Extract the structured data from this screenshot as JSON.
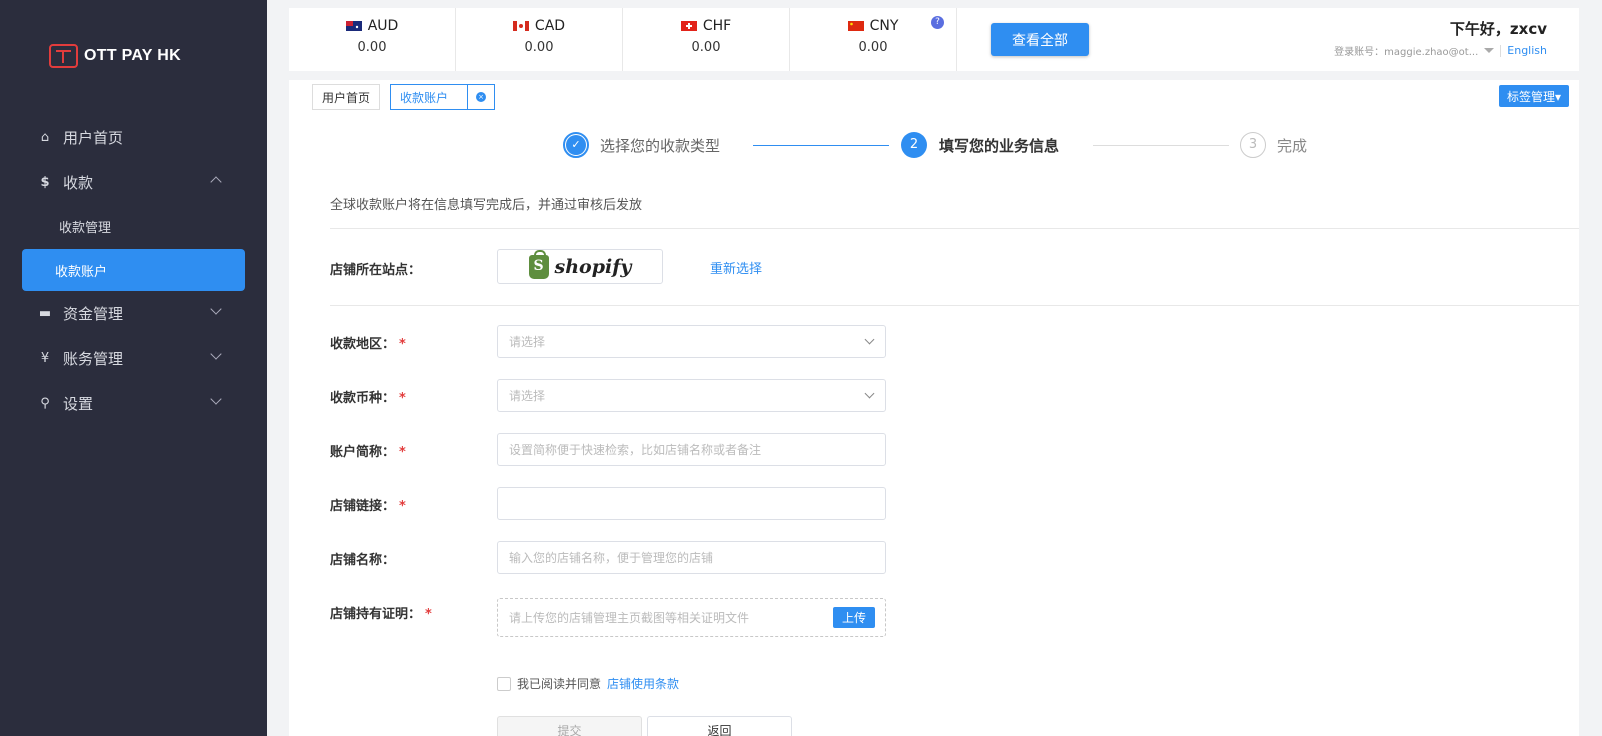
{
  "brand": {
    "logo_text": "OTT PAY HK",
    "accent": "#2f8ef1",
    "sidebar_bg": "#2b2d3d"
  },
  "sidebar": {
    "items": [
      {
        "label": "用户首页",
        "icon": "home-icon"
      },
      {
        "label": "收款",
        "icon": "dollar-icon"
      },
      {
        "label": "资金管理",
        "icon": "card-icon"
      },
      {
        "label": "账务管理",
        "icon": "yen-icon"
      },
      {
        "label": "设置",
        "icon": "search-icon"
      }
    ],
    "sub_items": [
      {
        "label": "收款管理"
      },
      {
        "label": "收款账户",
        "active": true
      }
    ]
  },
  "topbar": {
    "currencies": [
      {
        "code": "AUD",
        "value": "0.00",
        "flag": "au-flag-icon"
      },
      {
        "code": "CAD",
        "value": "0.00",
        "flag": "ca-flag-icon"
      },
      {
        "code": "CHF",
        "value": "0.00",
        "flag": "ch-flag-icon"
      },
      {
        "code": "CNY",
        "value": "0.00",
        "flag": "cn-flag-icon"
      }
    ],
    "help_badge": "?",
    "view_all_label": "查看全部",
    "greeting": "下午好，zxcv",
    "account_label": "登录账号：maggie.zhao@ot...",
    "language": "English"
  },
  "tabs": {
    "items": [
      {
        "label": "用户首页"
      },
      {
        "label": "收款账户"
      }
    ],
    "close_glyph": "×",
    "tag_mgmt_label": "标签管理▾"
  },
  "steps": [
    {
      "label": "选择您的收款类型",
      "status": "done",
      "mark": "✓"
    },
    {
      "label": "填写您的业务信息",
      "status": "current",
      "mark": "2"
    },
    {
      "label": "完成",
      "status": "pending",
      "mark": "3"
    }
  ],
  "form": {
    "notice": "全球收款账户将在信息填写完成后，并通过审核后发放",
    "site_label": "店铺所在站点：",
    "platform_name": "shopify",
    "reselect_label": "重新选择",
    "region_label": "收款地区：",
    "region_placeholder": "请选择",
    "currency_label": "收款币种：",
    "currency_placeholder": "请选择",
    "alias_label": "账户简称：",
    "alias_placeholder": "设置简称便于快速检索，比如店铺名称或者备注",
    "link_label": "店铺链接：",
    "link_value": "",
    "name_label": "店铺名称：",
    "name_placeholder": "输入您的店铺名称，便于管理您的店铺",
    "proof_label": "店铺持有证明：",
    "proof_placeholder": "请上传您的店铺管理主页截图等相关证明文件",
    "upload_label": "上传",
    "required_mark": "*",
    "agree_text": "我已阅读并同意",
    "agree_link": "店铺使用条款",
    "submit_label": "提交",
    "back_label": "返回"
  }
}
